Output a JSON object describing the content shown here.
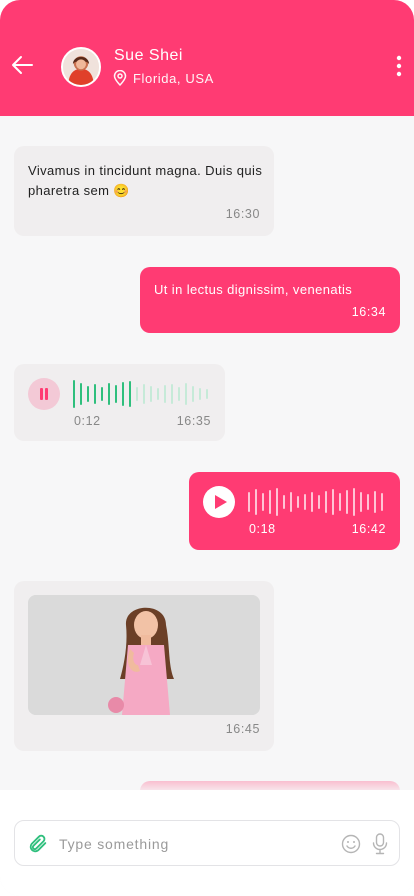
{
  "contact": {
    "name": "Sue Shei",
    "location": "Florida, USA"
  },
  "colors": {
    "accent": "#ff3b73",
    "wave_active": "#2fbf7d",
    "wave_inactive": "#c6ead8"
  },
  "icons": {
    "back": "arrow-left-icon",
    "location": "map-pin-icon",
    "more": "more-vertical-icon",
    "attach": "paperclip-icon",
    "emoji": "smile-icon",
    "mic": "microphone-icon"
  },
  "messages": [
    {
      "direction": "incoming",
      "type": "text",
      "text": "Vivamus in tincidunt magna. Duis quis pharetra sem 😊",
      "time": "16:30"
    },
    {
      "direction": "outgoing",
      "type": "text",
      "text": "Ut in lectus dignissim, venenatis",
      "time": "16:34"
    },
    {
      "direction": "incoming",
      "type": "voice",
      "duration": "0:12",
      "time": "16:35",
      "state": "playing",
      "progress": 0.45
    },
    {
      "direction": "outgoing",
      "type": "voice",
      "duration": "0:18",
      "time": "16:42",
      "state": "paused",
      "progress": 0
    },
    {
      "direction": "incoming",
      "type": "image",
      "time": "16:45"
    }
  ],
  "composer": {
    "placeholder": "Type something",
    "value": ""
  }
}
